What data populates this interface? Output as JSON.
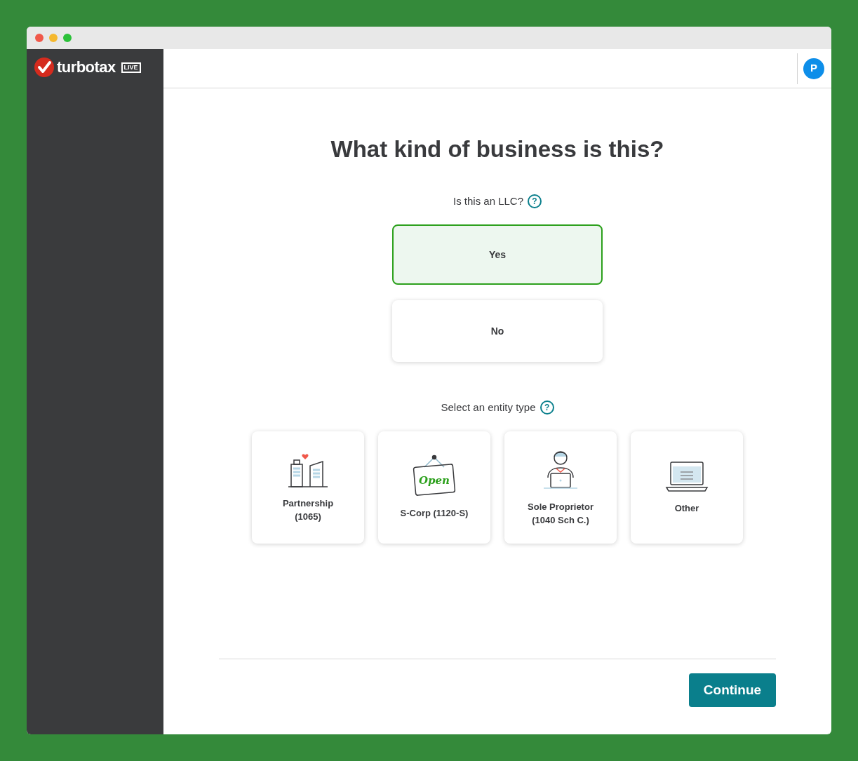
{
  "brand": {
    "name": "turbotax",
    "badge": "LIVE"
  },
  "header": {
    "avatar": "P"
  },
  "question": {
    "title": "What kind of business is this?"
  },
  "llc": {
    "label": "Is this an LLC?",
    "help": "?",
    "options": [
      {
        "label": "Yes",
        "selected": true
      },
      {
        "label": "No",
        "selected": false
      }
    ]
  },
  "entity": {
    "label": "Select an entity type",
    "help": "?",
    "options": [
      {
        "kind": "buildings",
        "lines": [
          "Partnership",
          "(1065)"
        ],
        "selected": false
      },
      {
        "kind": "sign",
        "sign_text": "Open",
        "lines": [
          "S-Corp (1120-S)"
        ],
        "selected": false
      },
      {
        "kind": "person",
        "lines": [
          "Sole Proprietor",
          "(1040 Sch C.)"
        ],
        "selected": false
      },
      {
        "kind": "laptop",
        "lines": [
          "Other"
        ],
        "selected": false
      }
    ]
  },
  "footer": {
    "button": "Continue"
  }
}
